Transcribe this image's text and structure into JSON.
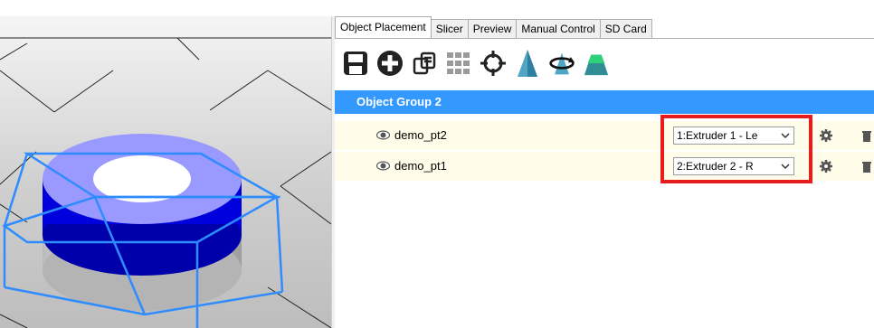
{
  "tabs": [
    {
      "label": "Object Placement",
      "active": true
    },
    {
      "label": "Slicer",
      "active": false
    },
    {
      "label": "Preview",
      "active": false
    },
    {
      "label": "Manual Control",
      "active": false
    },
    {
      "label": "SD Card",
      "active": false
    }
  ],
  "toolbar": {
    "icons": [
      "save-icon",
      "add-object-icon",
      "copy-icon",
      "autoposition-grid-icon",
      "center-object-icon",
      "scale-icon",
      "rotate-icon",
      "cut-icon"
    ]
  },
  "object_group": {
    "title": "Object Group 2",
    "objects": [
      {
        "name": "demo_pt2",
        "extruder": "1:Extruder 1 - Le",
        "visible_icon": "eye-icon"
      },
      {
        "name": "demo_pt1",
        "extruder": "2:Extruder 2 - R",
        "visible_icon": "eye-icon"
      }
    ]
  },
  "colors": {
    "header_bg": "#3399ff",
    "row_bg": "#fffde9",
    "highlight": "#e81c1c",
    "model_top": "#9999ff",
    "model_mid": "#0000dd",
    "bounding_box": "#3399ff"
  }
}
